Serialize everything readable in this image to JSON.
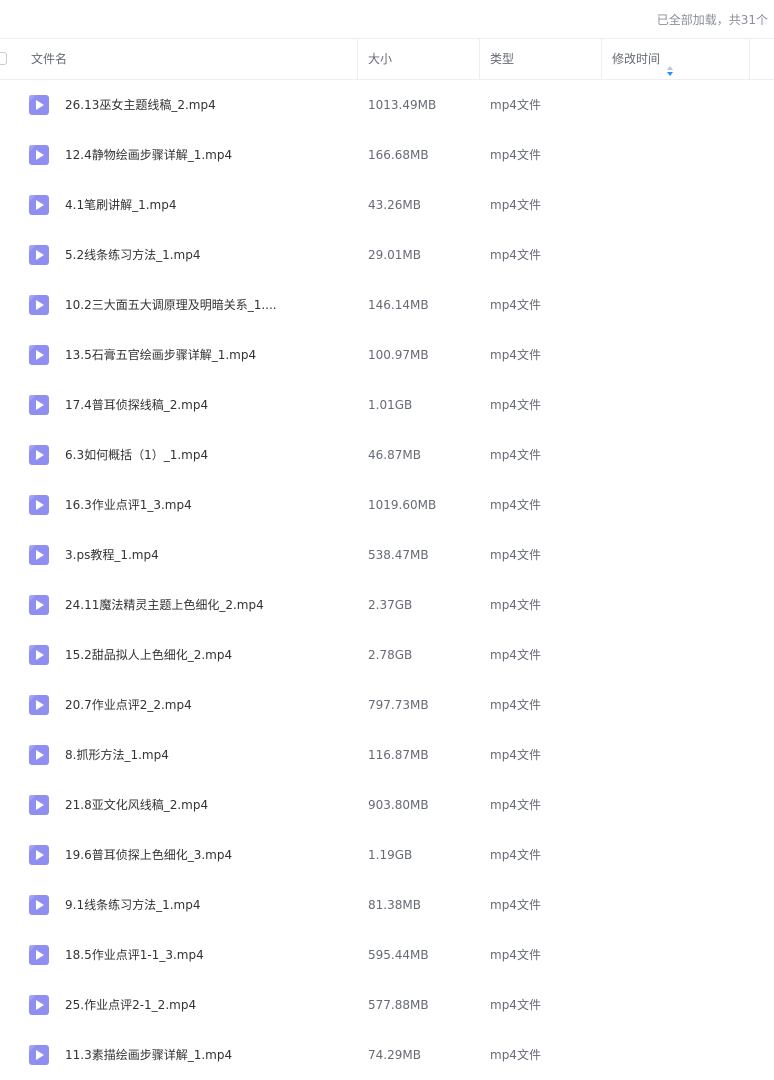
{
  "status": {
    "loaded_text": "已全部加载，共31个"
  },
  "columns": {
    "name": "文件名",
    "size": "大小",
    "type": "类型",
    "modified": "修改时间"
  },
  "colors": {
    "icon_bg": "#8f8ff2",
    "sort_accent": "#1e90ff"
  },
  "files": [
    {
      "name": "26.13巫女主题线稿_2.mp4",
      "size": "1013.49MB",
      "type": "mp4文件"
    },
    {
      "name": "12.4静物绘画步骤详解_1.mp4",
      "size": "166.68MB",
      "type": "mp4文件"
    },
    {
      "name": "4.1笔刷讲解_1.mp4",
      "size": "43.26MB",
      "type": "mp4文件"
    },
    {
      "name": "5.2线条练习方法_1.mp4",
      "size": "29.01MB",
      "type": "mp4文件"
    },
    {
      "name": "10.2三大面五大调原理及明暗关系_1....",
      "size": "146.14MB",
      "type": "mp4文件"
    },
    {
      "name": "13.5石膏五官绘画步骤详解_1.mp4",
      "size": "100.97MB",
      "type": "mp4文件"
    },
    {
      "name": "17.4普耳侦探线稿_2.mp4",
      "size": "1.01GB",
      "type": "mp4文件"
    },
    {
      "name": "6.3如何概括（1）_1.mp4",
      "size": "46.87MB",
      "type": "mp4文件"
    },
    {
      "name": "16.3作业点评1_3.mp4",
      "size": "1019.60MB",
      "type": "mp4文件"
    },
    {
      "name": "3.ps教程_1.mp4",
      "size": "538.47MB",
      "type": "mp4文件"
    },
    {
      "name": "24.11魔法精灵主题上色细化_2.mp4",
      "size": "2.37GB",
      "type": "mp4文件"
    },
    {
      "name": "15.2甜品拟人上色细化_2.mp4",
      "size": "2.78GB",
      "type": "mp4文件"
    },
    {
      "name": "20.7作业点评2_2.mp4",
      "size": "797.73MB",
      "type": "mp4文件"
    },
    {
      "name": "8.抓形方法_1.mp4",
      "size": "116.87MB",
      "type": "mp4文件"
    },
    {
      "name": "21.8亚文化风线稿_2.mp4",
      "size": "903.80MB",
      "type": "mp4文件"
    },
    {
      "name": "19.6普耳侦探上色细化_3.mp4",
      "size": "1.19GB",
      "type": "mp4文件"
    },
    {
      "name": "9.1线条练习方法_1.mp4",
      "size": "81.38MB",
      "type": "mp4文件"
    },
    {
      "name": "18.5作业点评1-1_3.mp4",
      "size": "595.44MB",
      "type": "mp4文件"
    },
    {
      "name": "25.作业点评2-1_2.mp4",
      "size": "577.88MB",
      "type": "mp4文件"
    },
    {
      "name": "11.3素描绘画步骤详解_1.mp4",
      "size": "74.29MB",
      "type": "mp4文件"
    }
  ]
}
